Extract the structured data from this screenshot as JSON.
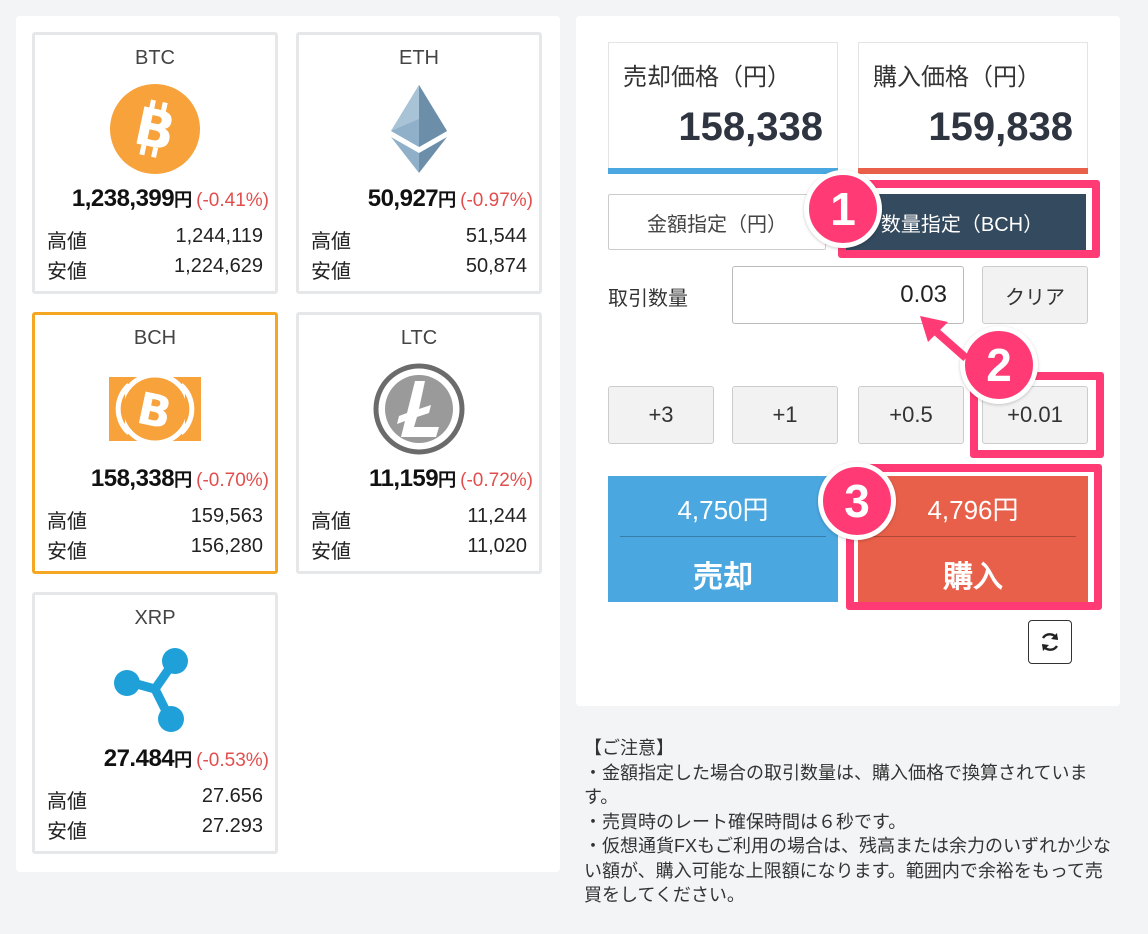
{
  "coins": [
    {
      "name": "BTC",
      "price": "1,238,399",
      "yen": "円",
      "change": "(-0.41%)",
      "high_label": "高値",
      "high": "1,244,119",
      "low_label": "安値",
      "low": "1,224,629",
      "logo_icon": "bitcoin-icon",
      "color": "#f7a23b"
    },
    {
      "name": "ETH",
      "price": "50,927",
      "yen": "円",
      "change": "(-0.97%)",
      "high_label": "高値",
      "high": "51,544",
      "low_label": "安値",
      "low": "50,874",
      "logo_icon": "ethereum-icon",
      "color": "#6d8ea9"
    },
    {
      "name": "BCH",
      "price": "158,338",
      "yen": "円",
      "change": "(-0.70%)",
      "high_label": "高値",
      "high": "159,563",
      "low_label": "安値",
      "low": "156,280",
      "logo_icon": "bitcoin-cash-icon",
      "color": "#f7a23b",
      "selected": true
    },
    {
      "name": "LTC",
      "price": "11,159",
      "yen": "円",
      "change": "(-0.72%)",
      "high_label": "高値",
      "high": "11,244",
      "low_label": "安値",
      "low": "11,020",
      "logo_icon": "litecoin-icon",
      "color": "#6b6b6b"
    },
    {
      "name": "XRP",
      "price": "27.484",
      "yen": "円",
      "change": "(-0.53%)",
      "high_label": "高値",
      "high": "27.656",
      "low_label": "安値",
      "low": "27.293",
      "logo_icon": "ripple-icon",
      "color": "#1fa0d8"
    }
  ],
  "trade": {
    "sell_price_label": "売却価格（円）",
    "sell_price": "158,338",
    "buy_price_label": "購入価格（円）",
    "buy_price": "159,838",
    "mode_amount_label": "金額指定（円）",
    "mode_qty_label": "数量指定（BCH）",
    "qty_label": "取引数量",
    "qty_value": "0.03",
    "clear_label": "クリア",
    "increments": [
      "+3",
      "+1",
      "+0.5",
      "+0.01"
    ],
    "sell_amount": "4,750円",
    "sell_label": "売却",
    "buy_amount": "4,796円",
    "buy_label": "購入"
  },
  "steps": [
    "1",
    "2",
    "3"
  ],
  "colors": {
    "highlight": "#ff3a74",
    "sell": "#4aa7e0",
    "buy": "#e9604a",
    "selected_border": "#f5a623",
    "mode_active": "#344a5e"
  },
  "notice": {
    "title": "【ご注意】",
    "lines": [
      "・金額指定した場合の取引数量は、購入価格で換算されています。",
      "・売買時のレート確保時間は６秒です。",
      "・仮想通貨FXもご利用の場合は、残高または余力のいずれか少ない額が、購入可能な上限額になります。範囲内で余裕をもって売買をしてください。"
    ]
  }
}
